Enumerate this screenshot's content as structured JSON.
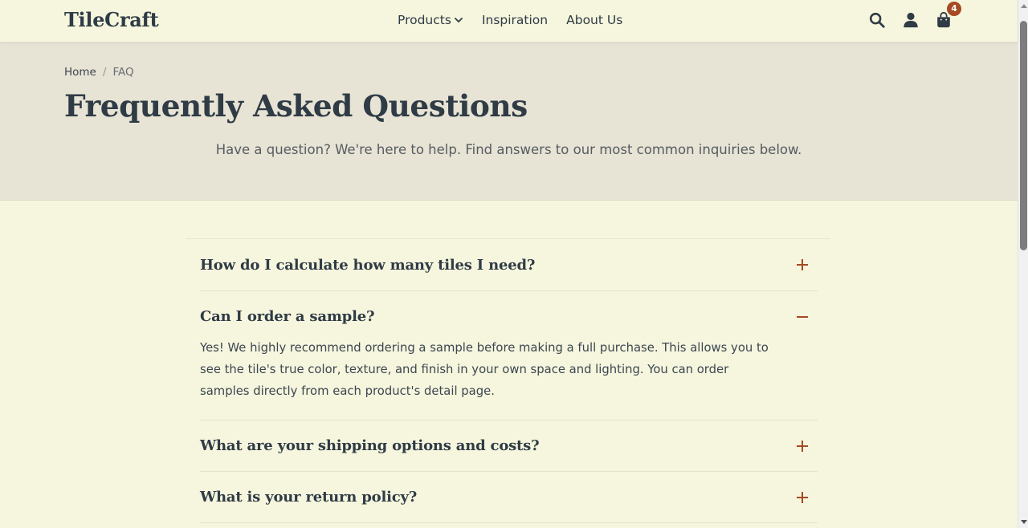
{
  "brand": {
    "logo": "TileCraft"
  },
  "nav": {
    "items": [
      {
        "label": "Products",
        "has_dropdown": true,
        "icon": "chevron-down-icon"
      },
      {
        "label": "Inspiration"
      },
      {
        "label": "About Us"
      }
    ]
  },
  "header_icons": {
    "search": "search-icon",
    "account": "user-icon",
    "cart": "shopping-bag-icon",
    "cart_count": "4"
  },
  "breadcrumb": {
    "home": "Home",
    "separator": "/",
    "current": "FAQ"
  },
  "hero": {
    "title": "Frequently Asked Questions",
    "subtitle": "Have a question? We're here to help. Find answers to our most common inquiries below."
  },
  "faq": [
    {
      "question": "How do I calculate how many tiles I need?",
      "expanded": false,
      "toggle": "plus-icon"
    },
    {
      "question": "Can I order a sample?",
      "expanded": true,
      "toggle": "minus-icon",
      "answer": "Yes! We highly recommend ordering a sample before making a full purchase. This allows you to see the tile's true color, texture, and finish in your own space and lighting. You can order samples directly from each product's detail page."
    },
    {
      "question": "What are your shipping options and costs?",
      "expanded": false,
      "toggle": "plus-icon"
    },
    {
      "question": "What is your return policy?",
      "expanded": false,
      "toggle": "plus-icon"
    }
  ],
  "colors": {
    "page_bg": "#f6f6de",
    "hero_bg": "#e7e3d5",
    "text": "#2f3b45",
    "accent": "#a54a22"
  }
}
